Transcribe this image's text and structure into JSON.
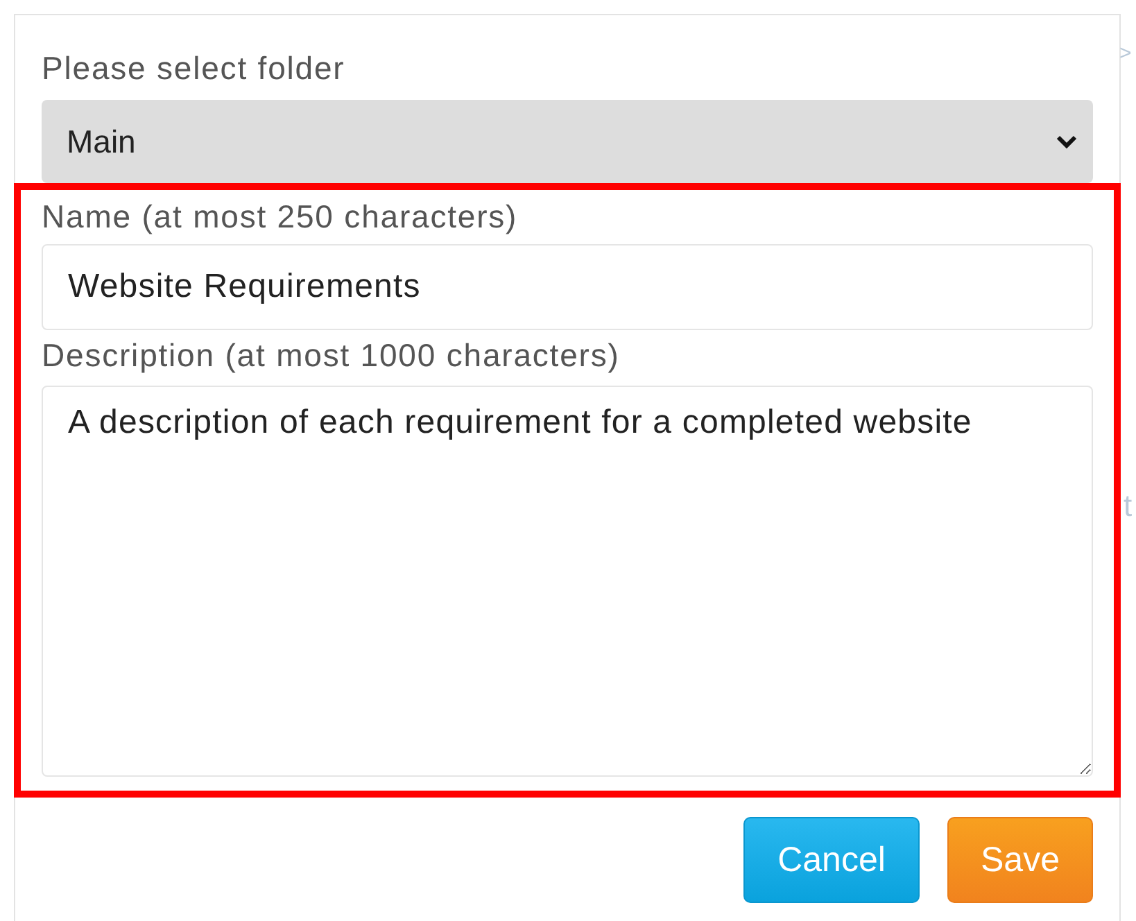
{
  "folder": {
    "label": "Please select folder",
    "value": "Main"
  },
  "name": {
    "label": "Name (at most 250 characters)",
    "value": "Website Requirements"
  },
  "description": {
    "label": "Description (at most 1000 characters)",
    "value": "A description of each requirement for a completed website"
  },
  "buttons": [
    {
      "label": "Cancel",
      "kind": "secondary"
    },
    {
      "label": "Save",
      "kind": "primary"
    }
  ],
  "background_fragments": [
    ">",
    "t"
  ]
}
